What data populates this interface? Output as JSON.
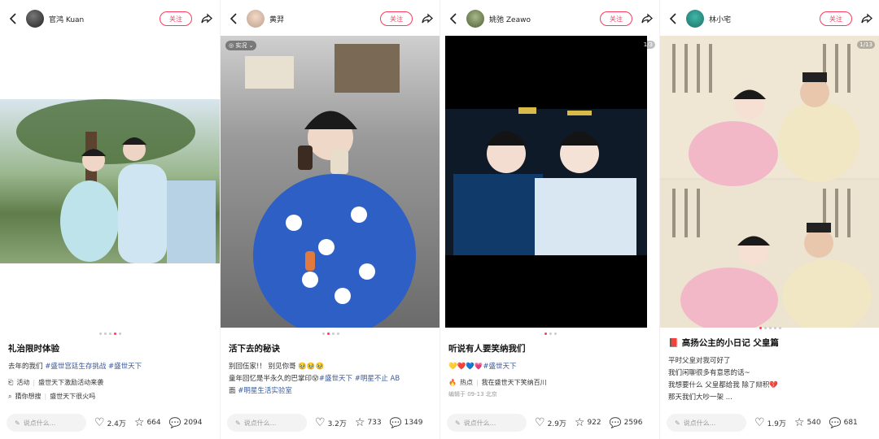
{
  "panels": [
    {
      "user": "官鸿 Kuan",
      "follow": "关注",
      "title": "礼治限时体验",
      "body": "去年的我们",
      "tags": "#盛世宫廷生存挑战 #盛世天下",
      "chip1_label": "活动",
      "chip1_text": "盛世天下激励活动来袭",
      "chip2_label": "猜你想搜",
      "chip2_text": "盛世天下很火吗",
      "say": "说点什么...",
      "likes": "2.4万",
      "stars": "664",
      "comments": "2094"
    },
    {
      "user": "黄羿",
      "follow": "关注",
      "live": "实况",
      "title": "活下去的秘诀",
      "line1": "别回伍家!！ 别见你哥",
      "line2": "童年回忆是半永久的巴掌印",
      "tags2": "#盛世天下 #明星不止 AB",
      "line3a": "面",
      "tags3": "#明星生活实验室",
      "say": "说点什么...",
      "likes": "3.2万",
      "stars": "733",
      "comments": "1349"
    },
    {
      "user": "姚弛 Zeawo",
      "follow": "关注",
      "counter": "1/3",
      "title": "听说有人要笑纳我们",
      "tags": "#盛世天下",
      "chip_label": "热点",
      "chip_text": "我在盛世天下笑纳百川",
      "date": "编辑于 09-13 北京",
      "say": "说点什么...",
      "likes": "2.9万",
      "stars": "922",
      "comments": "2596"
    },
    {
      "user": "林小宅",
      "follow": "关注",
      "counter": "1/13",
      "title": "高扬公主的小日记 父皇篇",
      "line1": "平时父皇对我可好了",
      "line2": "我们闲聊很多有意思的话~",
      "line3": "我想要什么 父皇都给我  除了辩积",
      "line4": "那天我们大吵一架 ...",
      "say": "说点什么...",
      "likes": "1.9万",
      "stars": "540",
      "comments": "681"
    }
  ],
  "colors": {
    "accent": "#ff3b5c",
    "tag": "#3b5998"
  }
}
